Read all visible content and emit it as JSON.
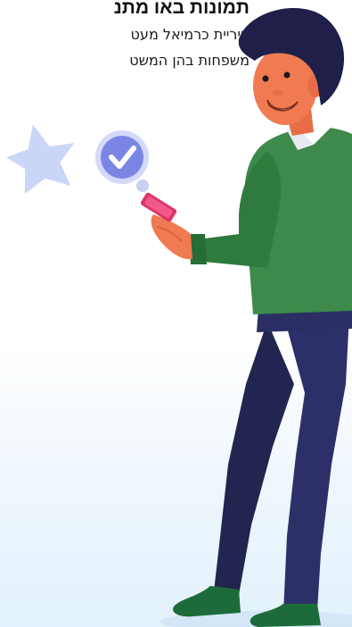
{
  "content": {
    "headline": "תמונות באו מתנ",
    "body_lines": [
      "עיריית כרמיאל מעט",
      "משפחות בהן המשט"
    ]
  },
  "illustration": {
    "badge_icon": "checkmark-icon",
    "decoration_icon": "star-icon",
    "colors": {
      "shirt": "#3d8a4b",
      "pants": "#2a2e63",
      "skin": "#f07a52",
      "hair": "#1f1f4a",
      "check_badge": "#7b86e4",
      "star": "#c9d6f8",
      "phone": "#e0336a"
    }
  }
}
